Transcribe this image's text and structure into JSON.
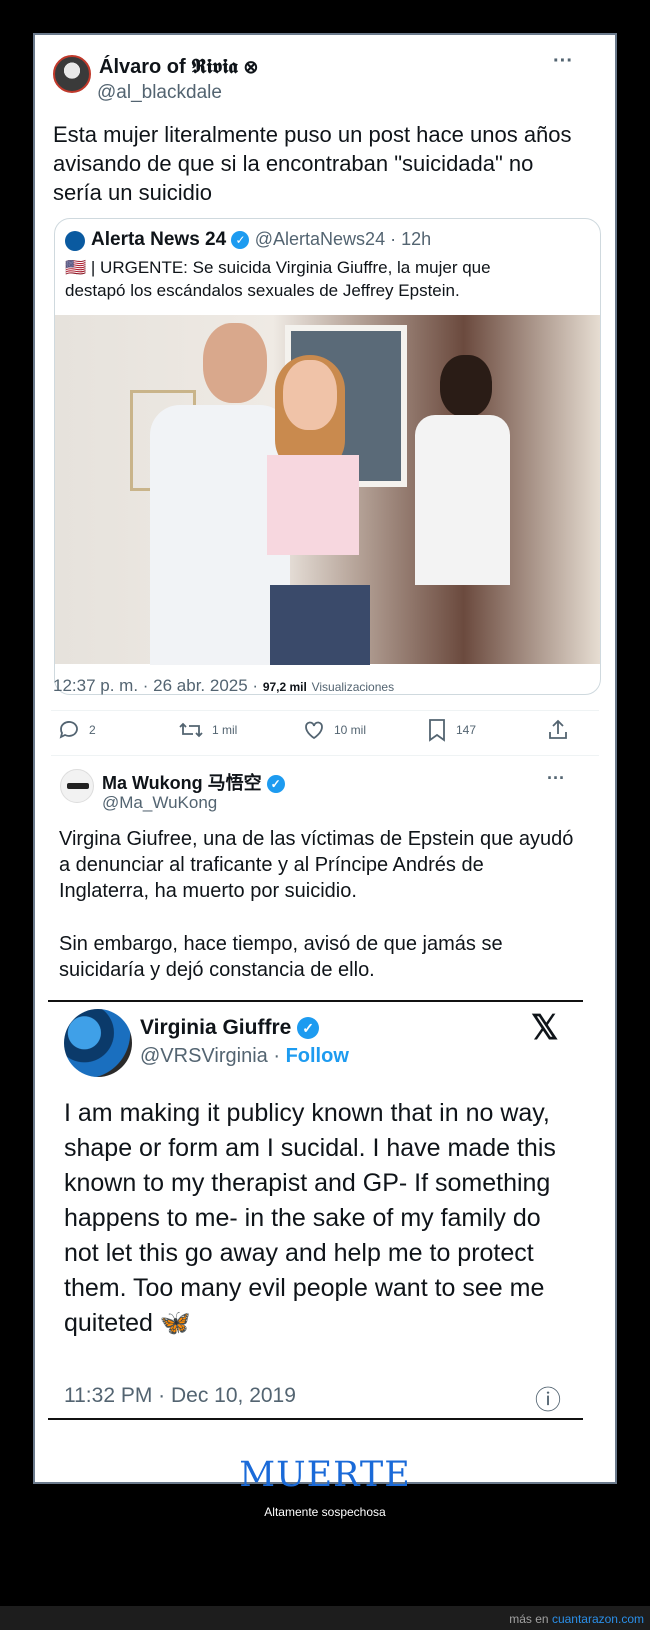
{
  "tweet": {
    "display_name": "Álvaro of 𝕽𝖎𝖛𝖎𝖆",
    "badge_glyph": "⊗",
    "handle": "@al_blackdale",
    "more_glyph": "···",
    "text": "Esta mujer literalmente puso un post hace unos años avisando de que si la encontraban \"suicidada\" no sería un suicidio",
    "timestamp": "12:37 p. m. · 26 abr. 2025 ·",
    "views_count": "97,2 mil",
    "views_label": "Visualizaciones"
  },
  "quoted": {
    "display_name": "Alerta News 24",
    "handle_time": "@AlertaNews24 · 12h",
    "flag": "🇺🇸",
    "text": "| URGENTE: Se suicida Virginia Giuffre, la mujer que destapó los escándalos sexuales de Jeffrey Epstein."
  },
  "actions": {
    "replies": "2",
    "retweets": "1 mil",
    "likes": "10 mil",
    "bookmarks": "147"
  },
  "reply": {
    "display_name": "Ma Wukong 马悟空",
    "handle": "@Ma_WuKong",
    "more_glyph": "···",
    "para1": "Virgina Giufree, una de las víctimas de Epstein que ayudó a denunciar al traficante y al Príncipe Andrés de Inglaterra, ha muerto por suicidio.",
    "para2": "Sin embargo, hace tiempo, avisó de que jamás se suicidaría y dejó constancia de ello."
  },
  "embedded": {
    "display_name": "Virginia Giuffre",
    "handle": "@VRSVirginia",
    "sep": "·",
    "follow": "Follow",
    "x_logo": "𝕏",
    "text": "I am making it publicy known that in no way, shape or form am I sucidal. I have made this known to my therapist and GP- If something happens to me- in the sake of my family do not let this go away and help me to protect them. Too many evil people want to see me quiteted",
    "emoji": "🦋",
    "timestamp": "11:32 PM · Dec 10, 2019",
    "info_glyph": "ⓘ"
  },
  "caption": {
    "title": "MUERTE",
    "subtitle": "Altamente sospechosa"
  },
  "footer": {
    "prefix": "más en",
    "site": "cuantarazon.com"
  },
  "colors": {
    "link_blue": "#1d9bf0",
    "caption_blue": "#1a6ad8",
    "muted": "#536471"
  }
}
